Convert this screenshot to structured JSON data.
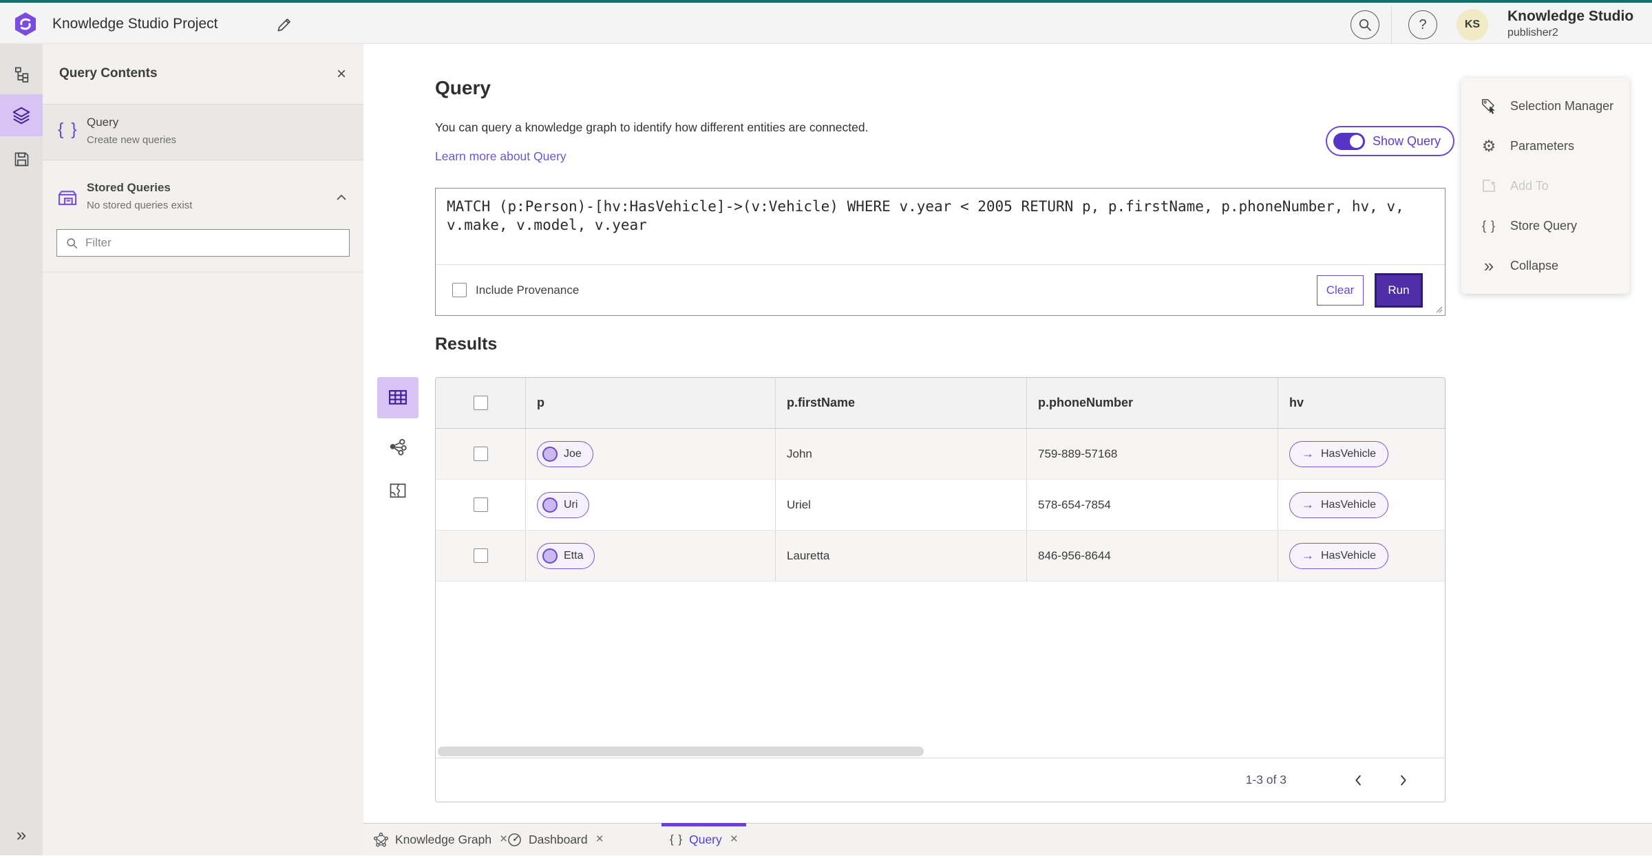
{
  "colors": {
    "accent_purple": "#6a49d0",
    "run_button_purple": "#4e2ea6",
    "brand_teal_top": "#156d70",
    "selected_lavender": "#d7c3f4",
    "avatar_yellow": "#f1eac6",
    "active_tab_purple": "#6d3fd4"
  },
  "icons": {
    "help_glyph": "?",
    "close": "×",
    "braces": "{ }",
    "gear": "⚙",
    "double_chevron_right": "»",
    "arrow_right": "→"
  },
  "header": {
    "title": "Knowledge Studio Project",
    "app_name": "Knowledge Studio",
    "username": "publisher2",
    "avatar_initials": "KS"
  },
  "contents_panel": {
    "title": "Query Contents",
    "query_item": {
      "label": "Query",
      "description": "Create new queries"
    },
    "stored_queries": {
      "label": "Stored Queries",
      "description": "No stored queries exist"
    },
    "filter_placeholder": "Filter"
  },
  "query_section": {
    "title": "Query",
    "description": "You can query a knowledge graph to identify how different entities are connected.",
    "learn_more": "Learn more about Query",
    "show_query_label": "Show Query",
    "query_text": "MATCH (p:Person)-[hv:HasVehicle]->(v:Vehicle) WHERE v.year < 2005 RETURN p, p.firstName, p.phoneNumber, hv, v, v.make, v.model, v.year",
    "include_provenance_label": "Include Provenance",
    "clear_label": "Clear",
    "run_label": "Run"
  },
  "results": {
    "title": "Results",
    "columns": [
      "p",
      "p.firstName",
      "p.phoneNumber",
      "hv"
    ],
    "rows": [
      {
        "p_label": "Joe",
        "first_name": "John",
        "phone": "759-889-57168",
        "hv_label": "HasVehicle"
      },
      {
        "p_label": "Uri",
        "first_name": "Uriel",
        "phone": "578-654-7854",
        "hv_label": "HasVehicle"
      },
      {
        "p_label": "Etta",
        "first_name": "Lauretta",
        "phone": "846-956-8644",
        "hv_label": "HasVehicle"
      }
    ],
    "pagination": "1-3 of 3"
  },
  "actions_panel": {
    "items": [
      {
        "label": "Selection Manager",
        "disabled": false
      },
      {
        "label": "Parameters",
        "disabled": false
      },
      {
        "label": "Add To",
        "disabled": true
      },
      {
        "label": "Store Query",
        "disabled": false
      },
      {
        "label": "Collapse",
        "disabled": false
      }
    ]
  },
  "tabs": [
    {
      "label": "Knowledge Graph",
      "active": false
    },
    {
      "label": "Dashboard",
      "active": false
    },
    {
      "label": "Query",
      "active": true
    }
  ]
}
